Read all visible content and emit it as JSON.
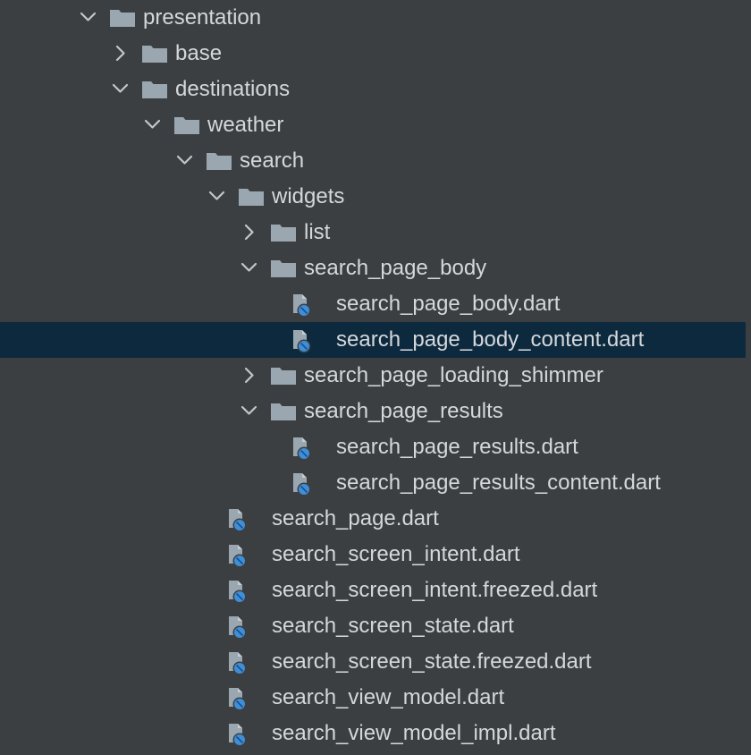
{
  "tree": [
    {
      "label": "presentation",
      "type": "folder",
      "depth": 0,
      "state": "expanded"
    },
    {
      "label": "base",
      "type": "folder",
      "depth": 1,
      "state": "collapsed"
    },
    {
      "label": "destinations",
      "type": "folder",
      "depth": 1,
      "state": "expanded"
    },
    {
      "label": "weather",
      "type": "folder",
      "depth": 2,
      "state": "expanded"
    },
    {
      "label": "search",
      "type": "folder",
      "depth": 3,
      "state": "expanded"
    },
    {
      "label": "widgets",
      "type": "folder",
      "depth": 4,
      "state": "expanded"
    },
    {
      "label": "list",
      "type": "folder",
      "depth": 5,
      "state": "collapsed"
    },
    {
      "label": "search_page_body",
      "type": "folder",
      "depth": 5,
      "state": "expanded"
    },
    {
      "label": "search_page_body.dart",
      "type": "dart-file",
      "depth": 6
    },
    {
      "label": "search_page_body_content.dart",
      "type": "dart-file",
      "depth": 6,
      "selected": true
    },
    {
      "label": "search_page_loading_shimmer",
      "type": "folder",
      "depth": 5,
      "state": "collapsed"
    },
    {
      "label": "search_page_results",
      "type": "folder",
      "depth": 5,
      "state": "expanded"
    },
    {
      "label": "search_page_results.dart",
      "type": "dart-file",
      "depth": 6
    },
    {
      "label": "search_page_results_content.dart",
      "type": "dart-file",
      "depth": 6
    },
    {
      "label": "search_page.dart",
      "type": "dart-file",
      "depth": 4
    },
    {
      "label": "search_screen_intent.dart",
      "type": "dart-file",
      "depth": 4
    },
    {
      "label": "search_screen_intent.freezed.dart",
      "type": "dart-file",
      "depth": 4
    },
    {
      "label": "search_screen_state.dart",
      "type": "dart-file",
      "depth": 4
    },
    {
      "label": "search_screen_state.freezed.dart",
      "type": "dart-file",
      "depth": 4
    },
    {
      "label": "search_view_model.dart",
      "type": "dart-file",
      "depth": 4
    },
    {
      "label": "search_view_model_impl.dart",
      "type": "dart-file",
      "depth": 4
    }
  ],
  "icons": {
    "folder": "folder-icon",
    "dart-file": "dart-file-icon",
    "expanded": "chevron-down-icon",
    "collapsed": "chevron-right-icon"
  },
  "colors": {
    "background": "#3c3f41",
    "selection": "#0d293e",
    "text": "#d5d8db",
    "folder_icon": "#9aa7b0",
    "dart_badge": "#3f8ed8"
  }
}
